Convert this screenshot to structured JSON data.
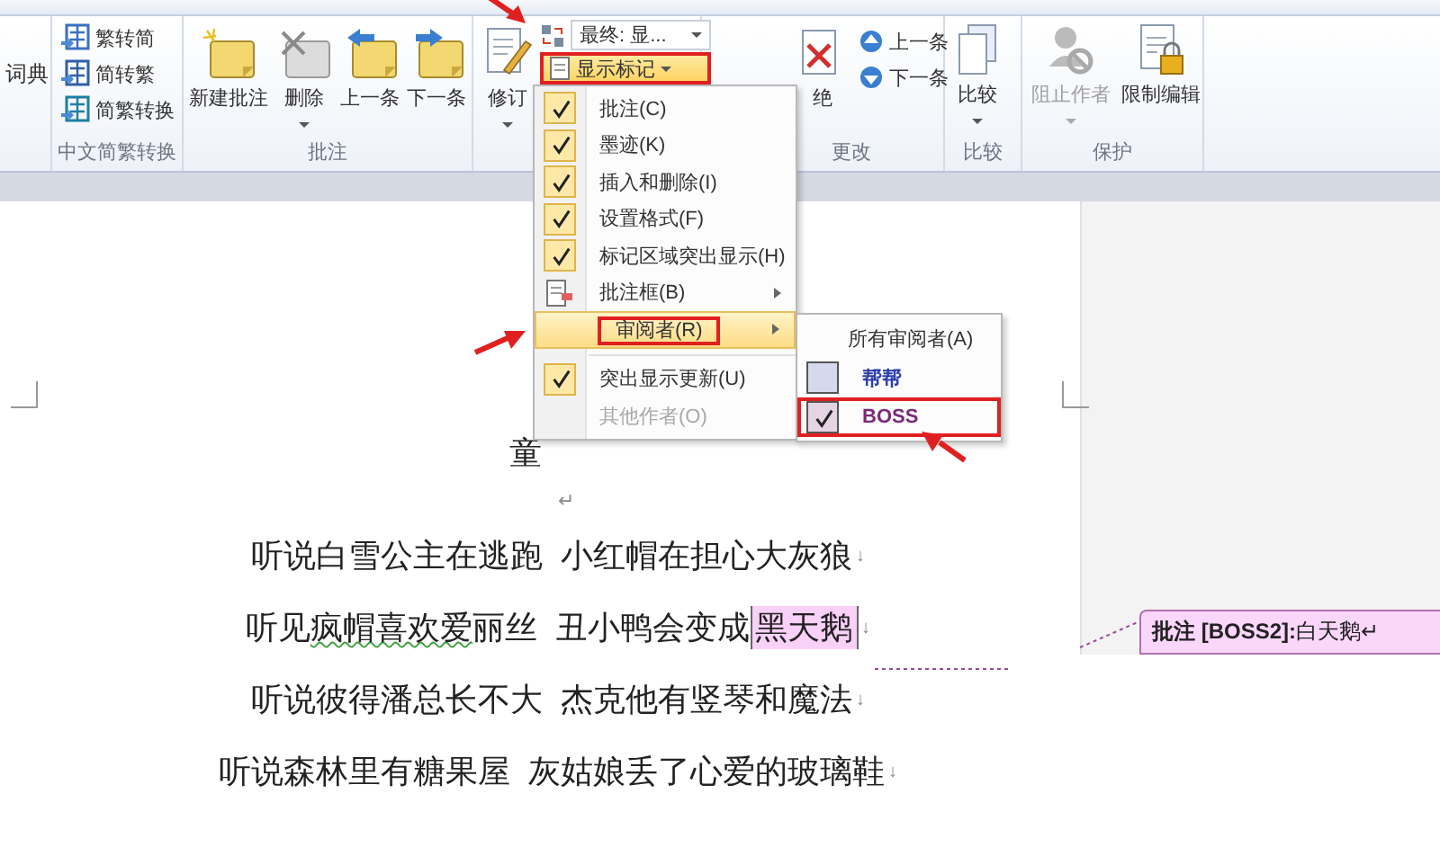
{
  "ribbon": {
    "dictionary_label": "词典",
    "chinese_conversion": {
      "buttons": [
        {
          "label": "繁转简",
          "kind": "to-simplified"
        },
        {
          "label": "简转繁",
          "kind": "to-traditional"
        },
        {
          "label": "简繁转换",
          "kind": "convert"
        }
      ],
      "label": "中文简繁转换"
    },
    "comments": {
      "buttons": [
        {
          "label": "新建批注",
          "kind": "new",
          "has_dropdown": false
        },
        {
          "label": "删除",
          "kind": "delete",
          "has_dropdown": true
        },
        {
          "label": "上一条",
          "kind": "previous",
          "has_dropdown": false
        },
        {
          "label": "下一条",
          "kind": "next",
          "has_dropdown": false
        }
      ],
      "label": "批注"
    },
    "tracking": {
      "track_changes": "修订",
      "display_for_review": "最终: 显...",
      "show_markup": "显示标记",
      "show_markup_outlined": true
    },
    "changes": {
      "reject": "绝",
      "previous": "上一条",
      "next": "下一条",
      "label": "更改"
    },
    "compare": {
      "button": "比较",
      "label": "比较"
    },
    "protect": {
      "buttons": [
        {
          "label": "阻止作者",
          "disabled": true,
          "kind": "block"
        },
        {
          "label": "限制编辑",
          "disabled": false,
          "kind": "restrict"
        }
      ],
      "label": "保护"
    }
  },
  "markup_menu": {
    "items": [
      {
        "kind": "check",
        "label": "批注(C)",
        "checked": true,
        "disabled": false
      },
      {
        "kind": "check",
        "label": "墨迹(K)",
        "checked": true,
        "disabled": false
      },
      {
        "kind": "check",
        "label": "插入和删除(I)",
        "checked": true,
        "disabled": false
      },
      {
        "kind": "check",
        "label": "设置格式(F)",
        "checked": true,
        "disabled": false
      },
      {
        "kind": "check",
        "label": "标记区域突出显示(H)",
        "checked": true,
        "disabled": false
      },
      {
        "kind": "submenu",
        "label": "批注框(B)",
        "selected": false,
        "outlined": false
      },
      {
        "kind": "submenu",
        "label": "审阅者(R)",
        "selected": true,
        "outlined": true
      },
      {
        "kind": "separator"
      },
      {
        "kind": "check",
        "label": "突出显示更新(U)",
        "checked": true,
        "disabled": false
      },
      {
        "kind": "check",
        "label": "其他作者(O)",
        "checked": false,
        "disabled": true
      }
    ]
  },
  "reviewers_menu": {
    "items": [
      {
        "kind": "all",
        "label": "所有审阅者(A)"
      },
      {
        "kind": "reviewer",
        "label": "帮帮",
        "checked": false,
        "color": "#2b3fa8",
        "outlined": false
      },
      {
        "kind": "reviewer",
        "label": "BOSS",
        "checked": true,
        "color": "#7a2a7a",
        "outlined": true
      }
    ]
  },
  "document": {
    "title": "童",
    "paragraph_mark": "↵",
    "lines": [
      {
        "segments": [
          {
            "text": "听说白雪公主在逃跑  小红帽在担心大灰狼",
            "kind": "plain"
          }
        ],
        "end_mark": "↓"
      },
      {
        "segments": [
          {
            "text": "听见",
            "kind": "plain"
          },
          {
            "text": "疯帽喜欢爱",
            "kind": "grammar"
          },
          {
            "text": "丽丝  丑小鸭会变成",
            "kind": "plain"
          },
          {
            "text": "黑天鹅",
            "kind": "comment"
          }
        ],
        "end_mark": "↓"
      },
      {
        "segments": [
          {
            "text": "听说彼得潘总长不大  杰克他有竖琴和魔法",
            "kind": "plain"
          }
        ],
        "end_mark": "↓"
      },
      {
        "segments": [
          {
            "text": "听说森林里有糖果屋  灰姑娘丢了心爱的玻璃鞋",
            "kind": "plain"
          }
        ],
        "end_mark": "↓"
      }
    ]
  },
  "comment_balloon": {
    "text": "**批注 [BOSS2]:**白天鹅↵"
  }
}
